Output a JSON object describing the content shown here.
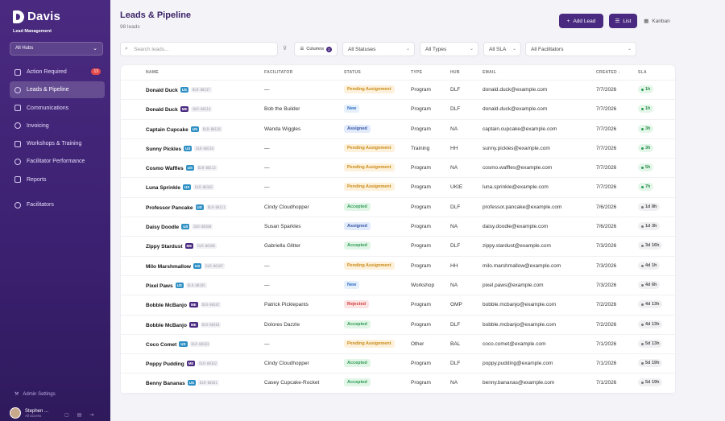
{
  "app": {
    "name": "Davis",
    "subtitle": "Lead Management"
  },
  "sidebar": {
    "hub_select": "All Hubs",
    "items": [
      {
        "label": "Action Required",
        "icon": "alert-circle-icon",
        "badge": "13"
      },
      {
        "label": "Leads & Pipeline",
        "icon": "users-icon",
        "active": true
      },
      {
        "label": "Communications",
        "icon": "chat-icon"
      },
      {
        "label": "Invoicing",
        "icon": "invoice-icon"
      },
      {
        "label": "Workshops & Training",
        "icon": "graduation-icon"
      },
      {
        "label": "Facilitator Performance",
        "icon": "chart-icon"
      },
      {
        "label": "Reports",
        "icon": "trend-icon"
      },
      {
        "label": "Facilitators",
        "icon": "gear-icon"
      }
    ],
    "admin_label": "Admin Settings",
    "user_name": "Stephen ...",
    "user_sub": "All access"
  },
  "header": {
    "title": "Leads & Pipeline",
    "count": "98 leads",
    "add_label": "Add Lead",
    "list_label": "List",
    "kanban_label": "Kanban"
  },
  "filters": {
    "search_placeholder": "Search leads...",
    "columns_label": "Columns",
    "columns_count": "2",
    "status": "All Statuses",
    "types": "All Types",
    "sla": "All SLA",
    "facilitators": "All Facilitators"
  },
  "table": {
    "headers": [
      "NAME",
      "FACILITATOR",
      "STATUS",
      "TYPE",
      "HUB",
      "EMAIL",
      "CREATED ↓",
      "SLA"
    ],
    "rows": [
      {
        "name": "Donald Duck",
        "tag": "US",
        "id": "DLR-00137",
        "facilitator": "—",
        "status": "Pending Assignment",
        "st": "pending",
        "type": "Program",
        "hub": "DLF",
        "email": "donald.duck@example.com",
        "created": "7/7/2026",
        "sla": "1h",
        "slac": "green"
      },
      {
        "name": "Donald Duck",
        "tag": "ME",
        "id": "DLR-00114",
        "facilitator": "Bob the Builder",
        "status": "New",
        "st": "new",
        "type": "Program",
        "hub": "DLF",
        "email": "donald.duck@example.com",
        "created": "7/7/2026",
        "sla": "1h",
        "slac": "green"
      },
      {
        "name": "Captain Cupcake",
        "tag": "US",
        "id": "DLR-00128",
        "facilitator": "Wanda Wiggles",
        "status": "Assigned",
        "st": "assigned",
        "type": "Program",
        "hub": "NA",
        "email": "captain.cupcake@example.com",
        "created": "7/7/2026",
        "sla": "3h",
        "slac": "green"
      },
      {
        "name": "Sunny Pickles",
        "tag": "US",
        "id": "DLR-00116",
        "facilitator": "—",
        "status": "Pending Assignment",
        "st": "pending",
        "type": "Training",
        "hub": "HH",
        "email": "sunny.pickles@example.com",
        "created": "7/7/2026",
        "sla": "3h",
        "slac": "green"
      },
      {
        "name": "Cosmo Waffles",
        "tag": "US",
        "id": "DLR-00113",
        "facilitator": "—",
        "status": "Pending Assignment",
        "st": "pending",
        "type": "Program",
        "hub": "NA",
        "email": "cosmo.waffles@example.com",
        "created": "7/7/2026",
        "sla": "5h",
        "slac": "green"
      },
      {
        "name": "Luna Sprinkle",
        "tag": "US",
        "id": "DLR-00102",
        "facilitator": "—",
        "status": "Pending Assignment",
        "st": "pending",
        "type": "Program",
        "hub": "UKIE",
        "email": "luna.sprinkle@example.com",
        "created": "7/7/2026",
        "sla": "7h",
        "slac": "green"
      },
      {
        "name": "Professor Pancake",
        "tag": "US",
        "id": "DLR-00111",
        "facilitator": "Cindy Cloudhopper",
        "status": "Accepted",
        "st": "accepted",
        "type": "Program",
        "hub": "DLF",
        "email": "professor.pancake@example.com",
        "created": "7/6/2026",
        "sla": "1d 8h",
        "slac": "grey"
      },
      {
        "name": "Daisy Doodle",
        "tag": "US",
        "id": "DLR-00108",
        "facilitator": "Susan Sparkles",
        "status": "Assigned",
        "st": "assigned",
        "type": "Program",
        "hub": "NA",
        "email": "daisy.doodle@example.com",
        "created": "7/6/2026",
        "sla": "1d 3h",
        "slac": "grey"
      },
      {
        "name": "Zippy Stardust",
        "tag": "ME",
        "id": "DLR-00106",
        "facilitator": "Gabriella Glitter",
        "status": "Accepted",
        "st": "accepted",
        "type": "Program",
        "hub": "DLF",
        "email": "zippy.stardust@example.com",
        "created": "7/3/2026",
        "sla": "3d 16h",
        "slac": "grey"
      },
      {
        "name": "Milo Marshmallow",
        "tag": "US",
        "id": "DLR-00107",
        "facilitator": "—",
        "status": "Pending Assignment",
        "st": "pending",
        "type": "Program",
        "hub": "HH",
        "email": "milo.marshmallow@example.com",
        "created": "7/3/2026",
        "sla": "4d 1h",
        "slac": "grey"
      },
      {
        "name": "Pixel Paws",
        "tag": "US",
        "id": "DLR-00105",
        "facilitator": "—",
        "status": "New",
        "st": "new",
        "type": "Workshop",
        "hub": "NA",
        "email": "pixel.paws@example.com",
        "created": "7/3/2026",
        "sla": "4d 6h",
        "slac": "grey"
      },
      {
        "name": "Bobble McBanjo",
        "tag": "ME",
        "id": "DLR-00107",
        "facilitator": "Patrick Picklepants",
        "status": "Rejected",
        "st": "rejected",
        "type": "Program",
        "hub": "GMP",
        "email": "bobble.mcbanjo@example.com",
        "created": "7/2/2026",
        "sla": "4d 13h",
        "slac": "grey"
      },
      {
        "name": "Bobble McBanjo",
        "tag": "ME",
        "id": "DLR-00104",
        "facilitator": "Dolores Dazzle",
        "status": "Accepted",
        "st": "accepted",
        "type": "Program",
        "hub": "DLF",
        "email": "bobble.mcbanjo@example.com",
        "created": "7/2/2026",
        "sla": "4d 13h",
        "slac": "grey"
      },
      {
        "name": "Coco Comet",
        "tag": "US",
        "id": "DLR-00103",
        "facilitator": "—",
        "status": "Pending Assignment",
        "st": "pending",
        "type": "Other",
        "hub": "BAL",
        "email": "coco.comet@example.com",
        "created": "7/1/2026",
        "sla": "5d 13h",
        "slac": "grey"
      },
      {
        "name": "Poppy Pudding",
        "tag": "ME",
        "id": "DLR-00102",
        "facilitator": "Cindy Cloudhopper",
        "status": "Accepted",
        "st": "accepted",
        "type": "Program",
        "hub": "DLF",
        "email": "poppy.pudding@example.com",
        "created": "7/1/2026",
        "sla": "5d 19h",
        "slac": "grey"
      },
      {
        "name": "Benny Bananas",
        "tag": "US",
        "id": "DLR-00101",
        "facilitator": "Casey Cupcake-Rocket",
        "status": "Accepted",
        "st": "accepted",
        "type": "Program",
        "hub": "NA",
        "email": "benny.bananas@example.com",
        "created": "7/1/2026",
        "sla": "5d 19h",
        "slac": "grey"
      }
    ]
  }
}
